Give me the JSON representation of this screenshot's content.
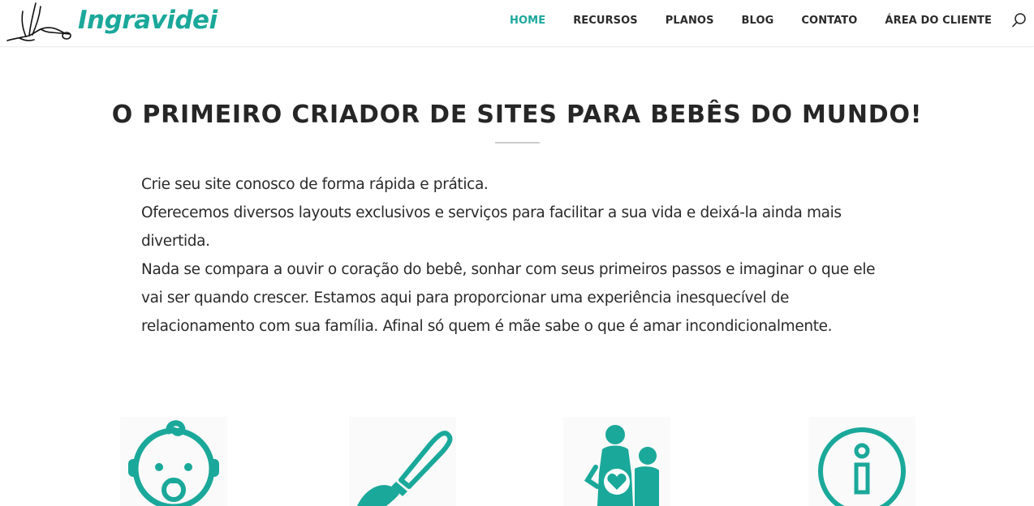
{
  "header": {
    "logo_text": "Ingravidei",
    "nav": [
      {
        "label": "HOME",
        "active": true
      },
      {
        "label": "RECURSOS",
        "active": false
      },
      {
        "label": "PLANOS",
        "active": false
      },
      {
        "label": "BLOG",
        "active": false
      },
      {
        "label": "CONTATO",
        "active": false
      },
      {
        "label": "ÁREA DO CLIENTE",
        "active": false
      }
    ],
    "search_icon": "search-icon"
  },
  "main": {
    "title": "O PRIMEIRO CRIADOR DE SITES PARA BEBÊS DO MUNDO!",
    "paragraphs": [
      "Crie seu site conosco de forma rápida e prática.",
      "Oferecemos diversos layouts exclusivos e serviços para facilitar a sua vida e deixá-la ainda mais divertida.",
      "Nada se compara a ouvir o coração do bebê, sonhar com seus primeiros passos e imaginar o que ele vai ser quando crescer. Estamos aqui para proporcionar uma experiência inesquecível de relacionamento com sua família. Afinal só quem é mãe sabe o que é amar incondicionalmente."
    ]
  },
  "features": [
    {
      "icon": "baby-face-icon"
    },
    {
      "icon": "paintbrush-icon"
    },
    {
      "icon": "family-heart-icon"
    },
    {
      "icon": "info-icon"
    }
  ],
  "colors": {
    "accent": "#1aa89a",
    "text": "#2b2b2b",
    "divider": "#cccccc"
  }
}
